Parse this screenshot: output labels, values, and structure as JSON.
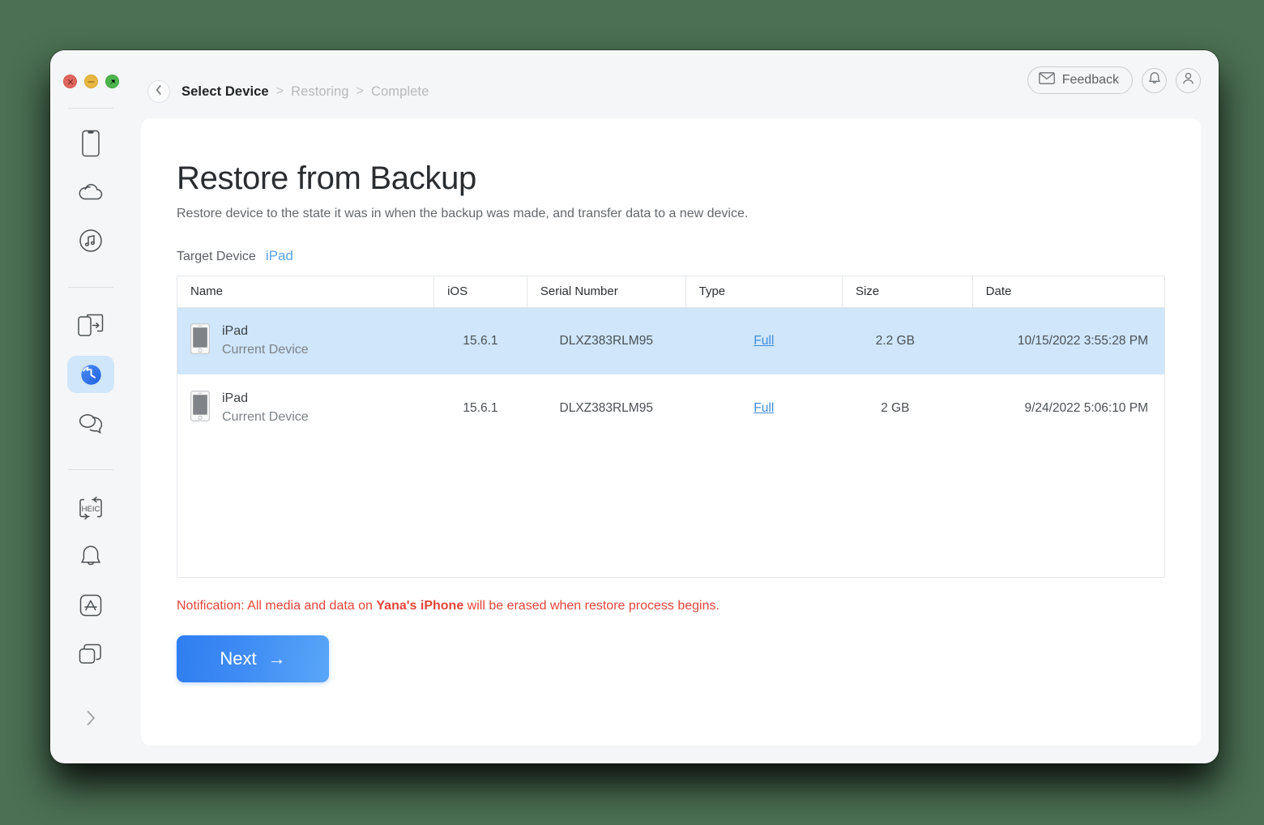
{
  "window": {
    "traffic_lights": [
      "close",
      "minimize",
      "maximize"
    ]
  },
  "sidebar": {
    "items": [
      {
        "icon": "device-phone-icon",
        "label": "Device",
        "active": false
      },
      {
        "icon": "cloud-icon",
        "label": "Cloud",
        "active": false
      },
      {
        "icon": "music-note-circle-icon",
        "label": "Music",
        "active": false
      },
      {
        "icon": "phone-transfer-icon",
        "label": "Transfer",
        "active": false
      },
      {
        "icon": "clock-history-icon",
        "label": "Restore",
        "active": true
      },
      {
        "icon": "chat-bubbles-icon",
        "label": "Messages",
        "active": false
      },
      {
        "icon": "heic-convert-icon",
        "label": "HEIC Converter",
        "active": false
      },
      {
        "icon": "bell-icon",
        "label": "Ringtone",
        "active": false
      },
      {
        "icon": "app-store-icon",
        "label": "App Manager",
        "active": false
      },
      {
        "icon": "windows-stack-icon",
        "label": "Apps",
        "active": false
      }
    ],
    "expand": {
      "icon": "chevron-right-icon",
      "label": "Expand"
    }
  },
  "header": {
    "feedback_label": "Feedback",
    "feedback_icon": "envelope-icon",
    "notification_icon": "bell-icon",
    "account_icon": "user-avatar-icon",
    "back_icon": "chevron-left-icon"
  },
  "breadcrumb": {
    "separator": ">",
    "items": [
      {
        "label": "Select Device",
        "active": true
      },
      {
        "label": "Restoring",
        "active": false
      },
      {
        "label": "Complete",
        "active": false
      }
    ]
  },
  "main": {
    "title": "Restore from Backup",
    "subtitle": "Restore device to the state it was in when the backup was made, and transfer data to a new device.",
    "target_device_label": "Target Device",
    "target_device_value": "iPad"
  },
  "table": {
    "columns": [
      "Name",
      "iOS",
      "Serial Number",
      "Type",
      "Size",
      "Date"
    ],
    "rows": [
      {
        "name": "iPad",
        "name_sub": "Current Device",
        "ios": "15.6.1",
        "serial": "DLXZ383RLM95",
        "type": "Full",
        "size": "2.2 GB",
        "date": "10/15/2022 3:55:28 PM",
        "selected": true,
        "device_icon": "iphone-icon"
      },
      {
        "name": "iPad",
        "name_sub": "Current Device",
        "ios": "15.6.1",
        "serial": "DLXZ383RLM95",
        "type": "Full",
        "size": "2 GB",
        "date": "9/24/2022 5:06:10 PM",
        "selected": false,
        "device_icon": "iphone-icon"
      }
    ]
  },
  "notice": {
    "prefix": "Notification: All media and data on ",
    "device": "Yana's iPhone",
    "suffix": " will be erased when restore process begins."
  },
  "footer": {
    "next_label": "Next",
    "next_arrow": "→"
  },
  "colors": {
    "desktop_background": "#4b7053",
    "accent_blue": "#3f8cf5",
    "selected_row": "#cfe6fb",
    "link_blue": "#3f8ad6",
    "target_blue": "#5aa2e8",
    "notice_red": "#e4453a"
  }
}
